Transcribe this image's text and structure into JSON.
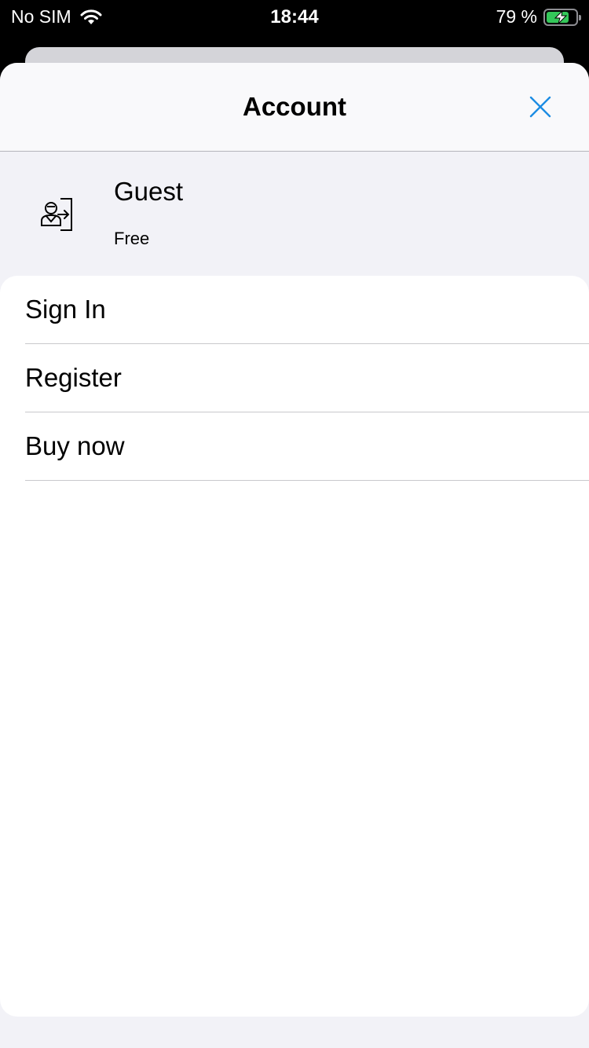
{
  "status": {
    "carrier": "No SIM",
    "time": "18:44",
    "battery_percent_text": "79 %",
    "battery_level": 0.79,
    "battery_color": "#34c759",
    "charging": true,
    "wifi_icon": "wifi-icon"
  },
  "sheet": {
    "title": "Account",
    "close_icon": "close-icon",
    "accent_color": "#1c8ce3"
  },
  "profile": {
    "icon": "sign-in-user-icon",
    "name": "Guest",
    "plan": "Free"
  },
  "menu": {
    "items": [
      {
        "label": "Sign In"
      },
      {
        "label": "Register"
      },
      {
        "label": "Buy now"
      }
    ]
  }
}
